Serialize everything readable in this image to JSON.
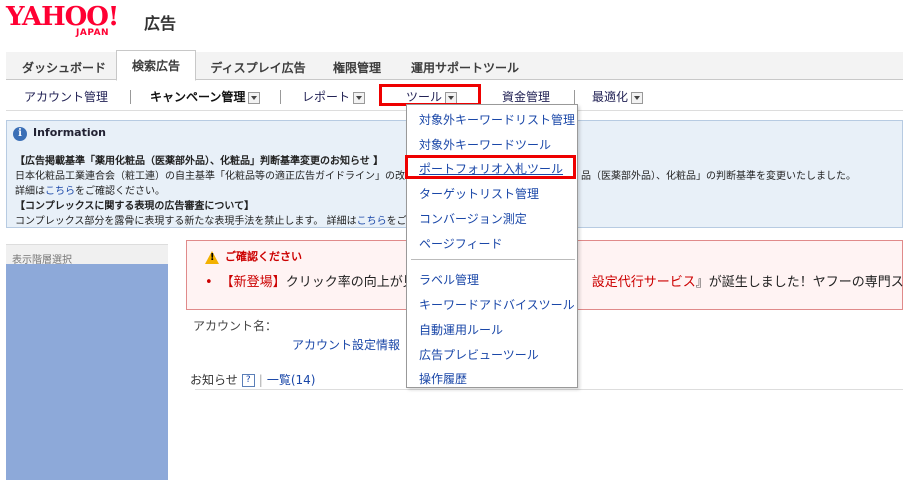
{
  "logo": {
    "brand": "YAHOO!",
    "sub": "JAPAN",
    "product": "広告"
  },
  "main_tabs": [
    "ダッシュボード",
    "検索広告",
    "ディスプレイ広告",
    "権限管理",
    "運用サポートツール"
  ],
  "sub_nav": {
    "account": "アカウント管理",
    "campaign": "キャンペーン管理",
    "report": "レポート",
    "tool": "ツール",
    "funds": "資金管理",
    "optimize": "最適化"
  },
  "info": {
    "title": "Information",
    "line1": "【広告掲載基準「薬用化粧品（医薬部外品）、化粧品」判断基準変更のお知らせ 】",
    "line2a": "日本化粧品工業連合会（粧工連）の自主基準「化粧品等の適正広告ガイドライン」の改",
    "line2b": "品（医薬部外品）、化粧品」の判断基準を変更いたしました。",
    "line3_pre": "詳細は",
    "line3_link": "こちら",
    "line3_post": "をご確認ください。",
    "line4": "【コンプレックスに関する表現の広告審査について】",
    "line5_pre": "コンプレックス部分を露骨に表現する新たな表現手法を禁止します。 詳細は",
    "line5_link": "こちら",
    "line5_post": "をご"
  },
  "left_panel": {
    "label": "表示階層選択"
  },
  "notice": {
    "title": "ご確認ください",
    "bullet": "•",
    "new_tag": "【新登場】",
    "text1": "クリック率の向上が見",
    "text2": "設定代行サービス",
    "text3": "』が誕生しました！ヤフーの専門ス"
  },
  "account": {
    "label": "アカウント名：",
    "link": "アカウント設定情報"
  },
  "news": {
    "label": "お知らせ",
    "help": "?",
    "list": "一覧(14)"
  },
  "tool_menu": [
    "対象外キーワードリスト管理",
    "対象外キーワードツール",
    "ポートフォリオ入札ツール",
    "ターゲットリスト管理",
    "コンバージョン測定",
    "ページフィード",
    "ラベル管理",
    "キーワードアドバイスツール",
    "自動運用ルール",
    "広告プレビューツール",
    "操作履歴"
  ]
}
